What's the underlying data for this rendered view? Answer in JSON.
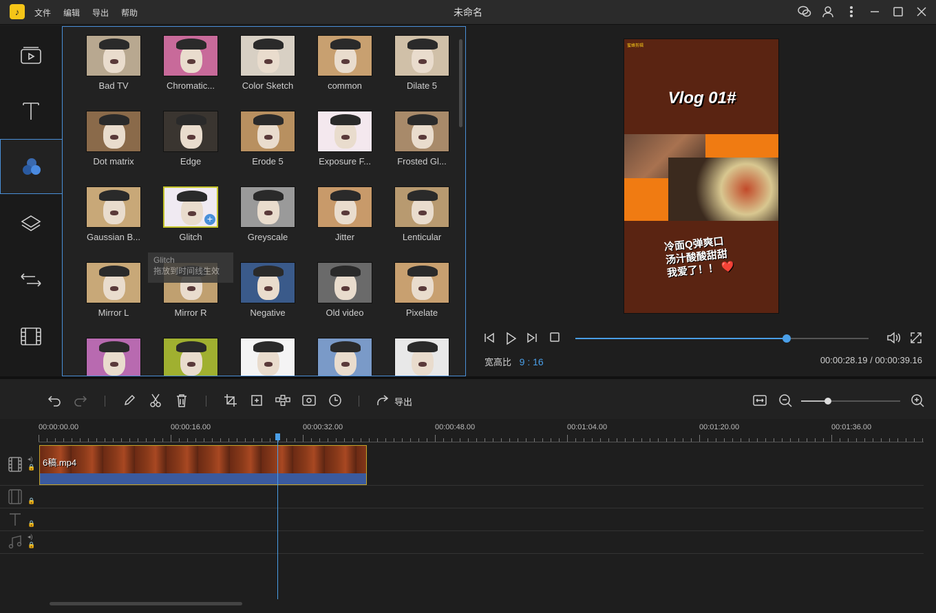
{
  "app": {
    "logo_glyph": "♪",
    "menu": [
      "文件",
      "编辑",
      "导出",
      "帮助"
    ],
    "title": "未命名"
  },
  "sidebar": {
    "items": [
      {
        "name": "media-icon"
      },
      {
        "name": "text-icon"
      },
      {
        "name": "filters-icon",
        "active": true
      },
      {
        "name": "overlays-icon"
      },
      {
        "name": "transitions-icon"
      },
      {
        "name": "elements-icon"
      }
    ]
  },
  "effects": {
    "items": [
      {
        "label": "Bad TV",
        "tint": "#b8a890"
      },
      {
        "label": "Chromatic...",
        "tint": "#c86a9a"
      },
      {
        "label": "Color Sketch",
        "tint": "#d8d0c4"
      },
      {
        "label": "common",
        "tint": "#c8a070"
      },
      {
        "label": "Dilate 5",
        "tint": "#d0c0a8"
      },
      {
        "label": "Dot matrix",
        "tint": "#8a6a4a"
      },
      {
        "label": "Edge",
        "tint": "#3a3530"
      },
      {
        "label": "Erode 5",
        "tint": "#b89060"
      },
      {
        "label": "Exposure F...",
        "tint": "#f4e8ee"
      },
      {
        "label": "Frosted Gl...",
        "tint": "#a88a6a"
      },
      {
        "label": "Gaussian B...",
        "tint": "#c8a878"
      },
      {
        "label": "Glitch",
        "tint": "#f0eaf2",
        "selected": true
      },
      {
        "label": "Greyscale",
        "tint": "#9a9a9a"
      },
      {
        "label": "Jitter",
        "tint": "#c89a6a"
      },
      {
        "label": "Lenticular",
        "tint": "#b89a70"
      },
      {
        "label": "Mirror L",
        "tint": "#c8a878"
      },
      {
        "label": "Mirror R",
        "tint": "#c0a070"
      },
      {
        "label": "Negative",
        "tint": "#3a5a8a"
      },
      {
        "label": "Old video",
        "tint": "#6a6a6a"
      },
      {
        "label": "Pixelate",
        "tint": "#c8a070"
      },
      {
        "label": "",
        "tint": "#b86ab0"
      },
      {
        "label": "",
        "tint": "#a0b030"
      },
      {
        "label": "",
        "tint": "#f4f4f4"
      },
      {
        "label": "",
        "tint": "#7a9ac8"
      },
      {
        "label": "",
        "tint": "#e8e8e8"
      }
    ],
    "tooltip": "Glitch\n拖放到时间线生效"
  },
  "preview": {
    "brand": "蜜蜂剪辑",
    "vlog_title": "Vlog 01#",
    "caption_lines": [
      "冷面Q弹爽口",
      "汤汁酸酸甜甜",
      "我爱了！！ ❤️"
    ],
    "progress": 0.72,
    "ratio_label": "宽高比",
    "ratio_value": "9 : 16",
    "timecode": "00:00:28.19 / 00:00:39.16"
  },
  "toolbar": {
    "export_label": "导出",
    "zoom_level": 0.27
  },
  "timeline": {
    "ruler_labels": [
      "00:00:00.00",
      "00:00:16.00",
      "00:00:32.00",
      "00:00:48.00",
      "00:01:04.00",
      "00:01:20.00",
      "00:01:36.00"
    ],
    "clip_name": "6稿.mp4"
  },
  "colors": {
    "accent": "#4a9fe8",
    "selected_border": "#c5c52a",
    "clip_border": "#c5a52a"
  }
}
